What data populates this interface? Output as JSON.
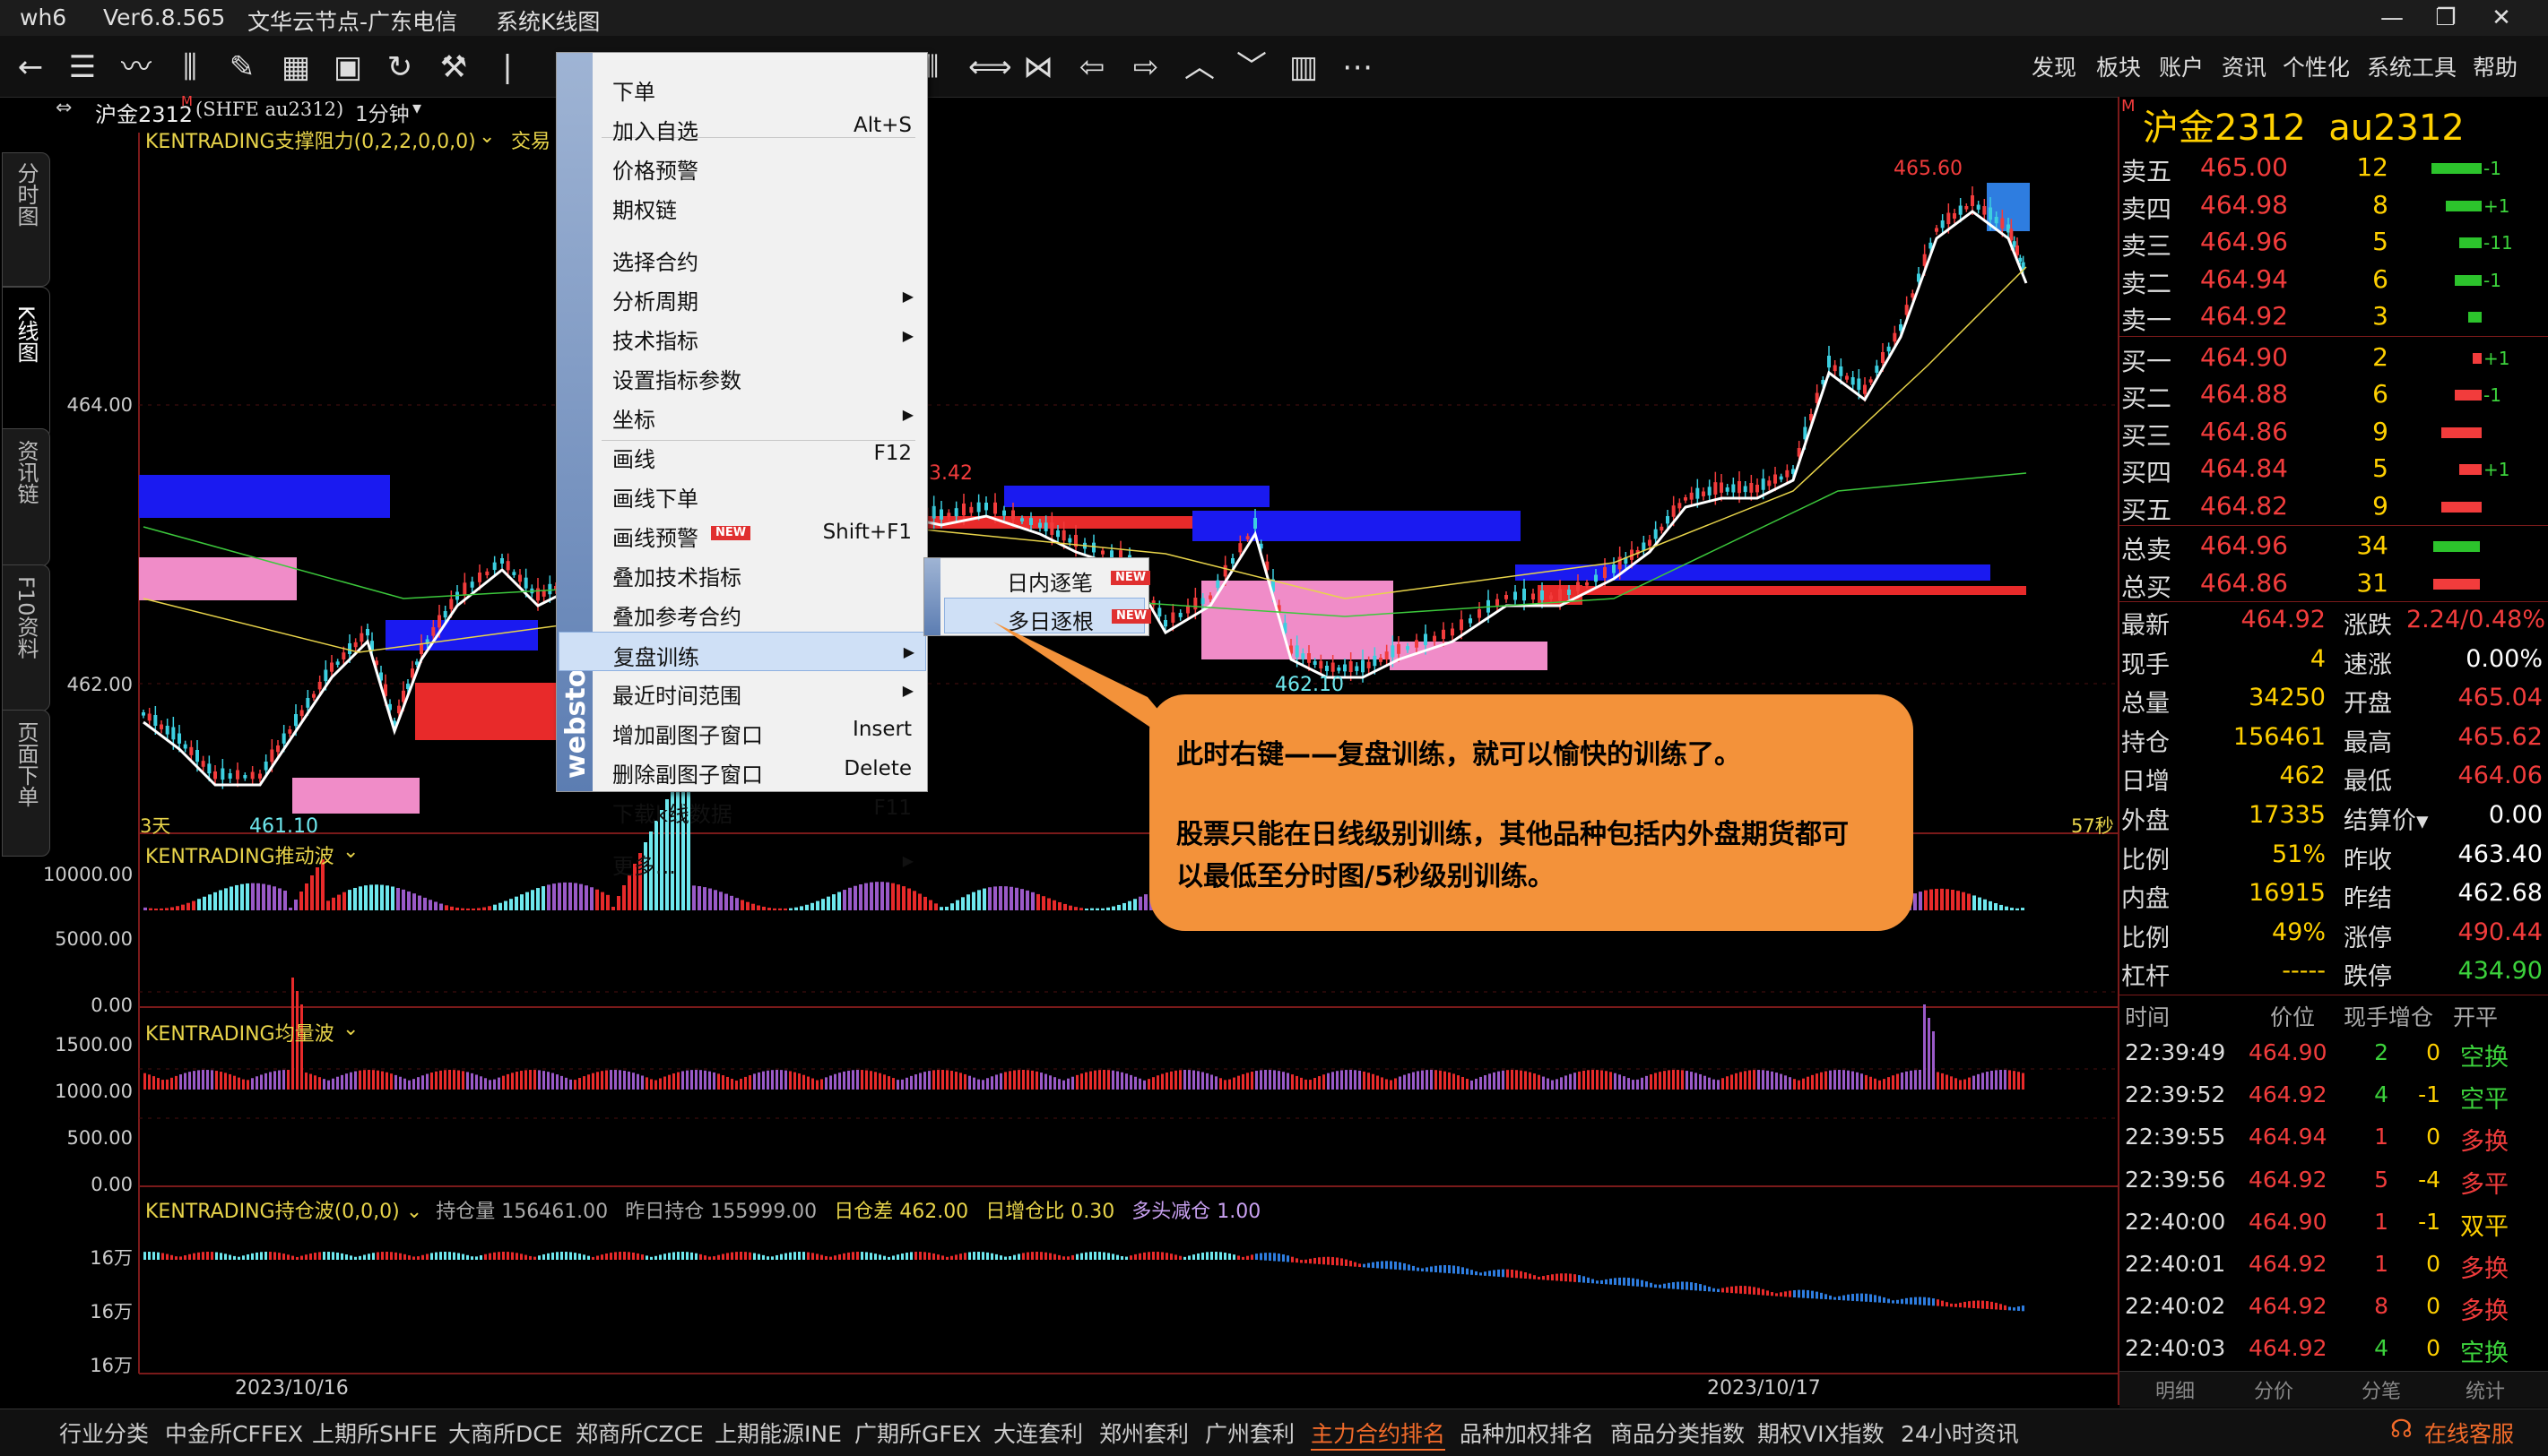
{
  "titlebar": {
    "app": "wh6",
    "version": "Ver6.8.565",
    "server": "文华云节点-广东电信",
    "view": "系统K线图"
  },
  "topmenu": [
    "发现",
    "板块",
    "账户",
    "资讯",
    "个性化",
    "系统工具",
    "帮助"
  ],
  "lefttabs": [
    "分时图",
    "K线图",
    "资讯链",
    "F10资料",
    "页面下单"
  ],
  "chart": {
    "symbol": "沪金2312",
    "symbol_flag": "M",
    "exchange_code": "(SHFE au2312)",
    "period": "1分钟",
    "main_indicator": "KENTRADING支撑阻力(0,2,2,0,0,0)",
    "main_indicator_tail": "交易",
    "price_ticks": [
      "464.00",
      "462.00"
    ],
    "high_label": "465.60",
    "low_label": "461.10",
    "mid_low_label": "462.10",
    "partial_label": "3.42",
    "days_label": "3天",
    "sec_label": "57秒",
    "ind2": {
      "name": "KENTRADING推动波",
      "ticks": [
        "10000.00",
        "5000.00",
        "0.00"
      ]
    },
    "ind3": {
      "name": "KENTRADING均量波",
      "ticks": [
        "1500.00",
        "1000.00",
        "500.00",
        "0.00"
      ]
    },
    "ind4": {
      "name": "KENTRADING持仓波(0,0,0)",
      "oi_label": "持仓量",
      "oi_value": "156461.00",
      "prev_label": "昨日持仓",
      "prev_value": "155999.00",
      "diff_label": "日仓差",
      "diff_value": "462.00",
      "ratio_label": "日增仓比",
      "ratio_value": "0.30",
      "trend": "多头减仓",
      "trend_value": "1.00",
      "ticks": [
        "16万",
        "16万",
        "16万"
      ]
    },
    "dates": [
      "2023/10/16",
      "2023/10/17"
    ],
    "colors": {
      "up": "#f23c3c",
      "down": "#3ccfe0",
      "ma1": "#ffffff",
      "ma2": "#e8d44a",
      "ma3": "#3cc83c",
      "zone_blue": "#1a1af0",
      "zone_pink": "#f08cc8",
      "zone_red": "#e82a2a"
    }
  },
  "context_menu": {
    "items": [
      {
        "label": "下单"
      },
      {
        "label": "加入自选",
        "key": "Alt+S"
      },
      {
        "label": "价格预警"
      },
      {
        "label": "期权链"
      },
      {
        "label": "选择合约"
      },
      {
        "label": "分析周期",
        "submenu": true
      },
      {
        "label": "技术指标",
        "submenu": true
      },
      {
        "label": "设置指标参数"
      },
      {
        "label": "坐标",
        "submenu": true
      },
      {
        "label": "画线",
        "key": "F12"
      },
      {
        "label": "画线下单"
      },
      {
        "label": "画线预警",
        "key": "Shift+F1",
        "badge": "NEW"
      },
      {
        "label": "叠加技术指标"
      },
      {
        "label": "叠加参考合约"
      },
      {
        "label": "复盘训练",
        "submenu": true,
        "highlight": true
      },
      {
        "label": "最近时间范围",
        "submenu": true
      },
      {
        "label": "增加副图子窗口",
        "key": "Insert"
      },
      {
        "label": "删除副图子窗口",
        "key": "Delete"
      },
      {
        "label": "下载k线数据",
        "key": "F11"
      },
      {
        "label": "更多...",
        "submenu": true
      }
    ],
    "watermark": "webstock",
    "submenu": [
      {
        "label": "日内逐笔",
        "badge": "NEW"
      },
      {
        "label": "多日逐根",
        "badge": "NEW"
      }
    ]
  },
  "callout": {
    "line1": "此时右键——复盘训练，就可以愉快的训练了。",
    "line2": "股票只能在日线级别训练，其他品种包括内外盘期货都可",
    "line3": "以最低至分时图/5秒级别训练。"
  },
  "quote": {
    "title": "沪金2312  au2312",
    "flag": "M",
    "asks": [
      {
        "label": "卖五",
        "price": "465.00",
        "vol": "12",
        "chg": "-1"
      },
      {
        "label": "卖四",
        "price": "464.98",
        "vol": "8",
        "chg": "+1"
      },
      {
        "label": "卖三",
        "price": "464.96",
        "vol": "5",
        "chg": "-11"
      },
      {
        "label": "卖二",
        "price": "464.94",
        "vol": "6",
        "chg": "-1"
      },
      {
        "label": "卖一",
        "price": "464.92",
        "vol": "3",
        "chg": ""
      }
    ],
    "bids": [
      {
        "label": "买一",
        "price": "464.90",
        "vol": "2",
        "chg": "+1"
      },
      {
        "label": "买二",
        "price": "464.88",
        "vol": "6",
        "chg": "-1"
      },
      {
        "label": "买三",
        "price": "464.86",
        "vol": "9",
        "chg": ""
      },
      {
        "label": "买四",
        "price": "464.84",
        "vol": "5",
        "chg": "+1"
      },
      {
        "label": "买五",
        "price": "464.82",
        "vol": "9",
        "chg": ""
      }
    ],
    "totals": [
      {
        "label": "总卖",
        "price": "464.96",
        "vol": "34"
      },
      {
        "label": "总买",
        "price": "464.86",
        "vol": "31"
      }
    ],
    "stats": [
      [
        "最新",
        "464.92",
        "涨跌",
        "2.24/0.48%"
      ],
      [
        "现手",
        "4",
        "速涨",
        "0.00%"
      ],
      [
        "总量",
        "34250",
        "开盘",
        "465.04"
      ],
      [
        "持仓",
        "156461",
        "最高",
        "465.62"
      ],
      [
        "日增",
        "462",
        "最低",
        "464.06"
      ],
      [
        "外盘",
        "17335",
        "结算价▾",
        "0.00"
      ],
      [
        "比例",
        "51%",
        "昨收",
        "463.40"
      ],
      [
        "内盘",
        "16915",
        "昨结",
        "462.68"
      ],
      [
        "比例",
        "49%",
        "涨停",
        "490.44"
      ],
      [
        "杠杆",
        "-----",
        "跌停",
        "434.90"
      ]
    ],
    "tick_headers": [
      "时间",
      "价位",
      "现手",
      "增仓",
      "开平"
    ],
    "ticks": [
      [
        "22:39:49",
        "464.90",
        "2",
        "0",
        "空换"
      ],
      [
        "22:39:52",
        "464.92",
        "4",
        "-1",
        "空平"
      ],
      [
        "22:39:55",
        "464.94",
        "1",
        "0",
        "多换"
      ],
      [
        "22:39:56",
        "464.92",
        "5",
        "-4",
        "多平"
      ],
      [
        "22:40:00",
        "464.90",
        "1",
        "-1",
        "双平"
      ],
      [
        "22:40:01",
        "464.92",
        "1",
        "0",
        "多换"
      ],
      [
        "22:40:02",
        "464.92",
        "8",
        "0",
        "多换"
      ],
      [
        "22:40:03",
        "464.92",
        "4",
        "0",
        "空换"
      ]
    ],
    "bottom_tabs": [
      "明细",
      "分价",
      "分笔",
      "统计"
    ]
  },
  "bottom": {
    "tabs": [
      "行业分类",
      "中金所CFFEX",
      "上期所SHFE",
      "大商所DCE",
      "郑商所CZCE",
      "上期能源INE",
      "广期所GFEX",
      "大连套利",
      "郑州套利",
      "广州套利",
      "主力合约排名",
      "品种加权排名",
      "商品分类指数",
      "期权VIX指数",
      "24小时资讯"
    ],
    "active": "主力合约排名",
    "service": "在线客服"
  }
}
